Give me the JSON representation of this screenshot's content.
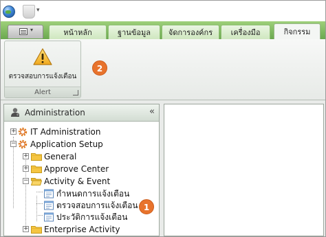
{
  "ribbon": {
    "tabs": [
      {
        "label": "หน้าหลัก",
        "active": false
      },
      {
        "label": "ฐานข้อมูล",
        "active": false
      },
      {
        "label": "จัดการองค์กร",
        "active": false
      },
      {
        "label": "เครื่องมือ",
        "active": false
      },
      {
        "label": "กิจกรรม",
        "active": true
      }
    ],
    "group": {
      "button_label": "ตรวจสอบการแจ้งเตือน",
      "label": "Alert"
    },
    "badge": "2"
  },
  "panel": {
    "title": "Administration",
    "collapse_glyph": "«"
  },
  "tree": {
    "it_administration": "IT Administration",
    "application_setup": "Application Setup",
    "general": "General",
    "approve_center": "Approve Center",
    "activity_event": "Activity & Event",
    "alert_config": "กำหนดการแจ้งเตือน",
    "alert_check": "ตรวจสอบการแจ้งเตือน",
    "alert_history": "ประวัติการแจ้งเตือน",
    "enterprise_activity": "Enterprise Activity"
  },
  "badge_tree": "1",
  "colors": {
    "tab_bar": "#6aa84f",
    "badge": "#e8732c",
    "folder": "#f5c542"
  },
  "icons": [
    "globe-icon",
    "warning-icon",
    "admin-icon",
    "gear-icon",
    "folder-icon",
    "form-icon"
  ]
}
